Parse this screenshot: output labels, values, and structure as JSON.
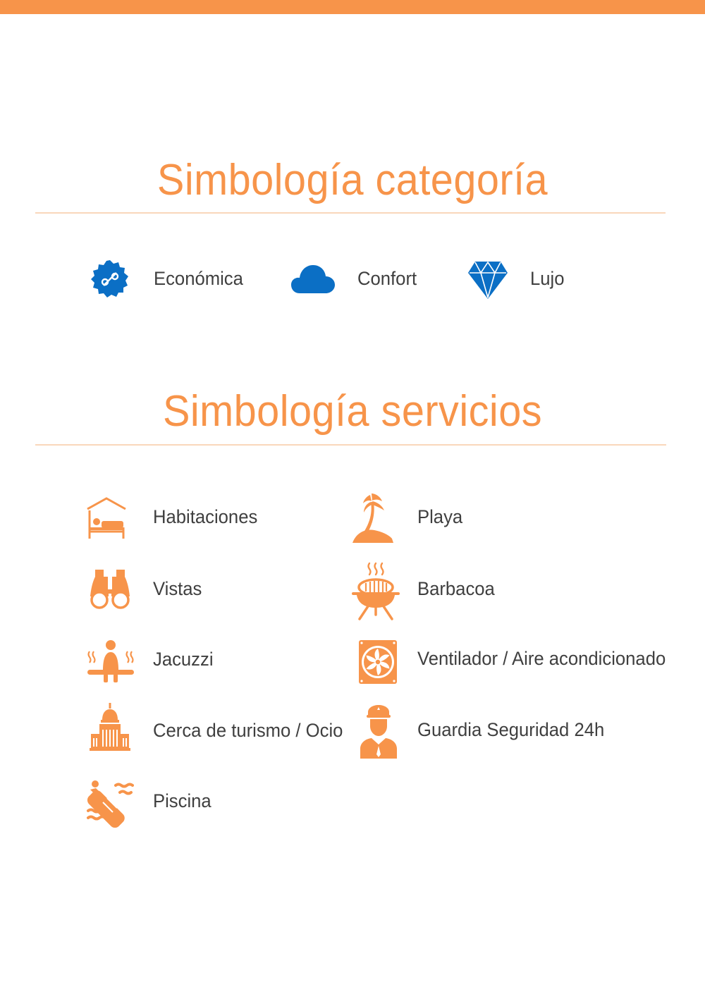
{
  "colors": {
    "accent": "#f7944a",
    "divider": "#f9d7bb",
    "blue": "#0b6fc5",
    "text": "#3f3f3f"
  },
  "categoria": {
    "title": "Simbología categoría",
    "items": [
      {
        "label": "Económica",
        "icon": "discount-badge-icon"
      },
      {
        "label": "Confort",
        "icon": "cloud-icon"
      },
      {
        "label": "Lujo",
        "icon": "diamond-icon"
      }
    ]
  },
  "servicios": {
    "title": "Simbología servicios",
    "items": [
      {
        "label": "Habitaciones",
        "icon": "bed-house-icon"
      },
      {
        "label": "Vistas",
        "icon": "binoculars-icon"
      },
      {
        "label": "Jacuzzi",
        "icon": "jacuzzi-icon"
      },
      {
        "label": "Cerca de turismo / Ocio",
        "icon": "capitol-building-icon"
      },
      {
        "label": "Piscina",
        "icon": "pool-float-icon"
      },
      {
        "label": "Playa",
        "icon": "palm-island-icon"
      },
      {
        "label": "Barbacoa",
        "icon": "barbecue-grill-icon"
      },
      {
        "label": "Ventilador / Aire acondicionado",
        "icon": "fan-icon"
      },
      {
        "label": "Guardia Seguridad 24h",
        "icon": "security-guard-icon"
      }
    ]
  }
}
